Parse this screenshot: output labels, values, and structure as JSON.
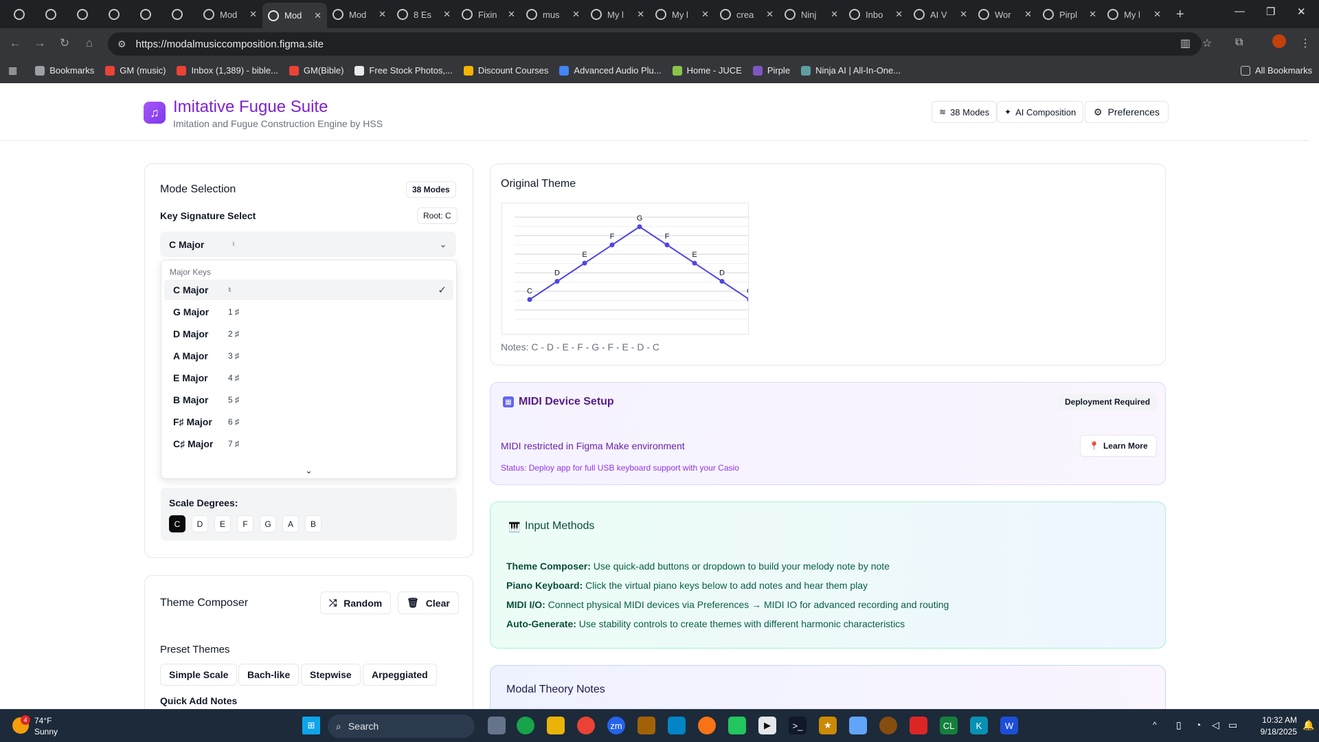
{
  "browser": {
    "tabs": [
      {
        "title": ""
      },
      {
        "title": ""
      },
      {
        "title": ""
      },
      {
        "title": ""
      },
      {
        "title": ""
      },
      {
        "title": ""
      },
      {
        "title": "Mod"
      },
      {
        "title": "Mod"
      },
      {
        "title": "Mod"
      },
      {
        "title": "8 Es"
      },
      {
        "title": "Fixin"
      },
      {
        "title": "mus"
      },
      {
        "title": "My l"
      },
      {
        "title": "My l"
      },
      {
        "title": "crea"
      },
      {
        "title": "Ninj"
      },
      {
        "title": "Inbo"
      },
      {
        "title": "AI V"
      },
      {
        "title": "Wor"
      },
      {
        "title": "Pirpl"
      },
      {
        "title": "My l"
      }
    ],
    "url": "https://modalmusiccomposition.figma.site",
    "bookmarks": [
      {
        "label": "Bookmarks",
        "color": "#9aa0a6"
      },
      {
        "label": "GM (music)",
        "color": "#ea4335"
      },
      {
        "label": "Inbox (1,389) - bible...",
        "color": "#ea4335"
      },
      {
        "label": "GM(Bible)",
        "color": "#ea4335"
      },
      {
        "label": "Free Stock Photos,...",
        "color": "#e8eaed"
      },
      {
        "label": "Discount Courses",
        "color": "#f4b400"
      },
      {
        "label": "Advanced Audio Plu...",
        "color": "#4285f4"
      },
      {
        "label": "Home - JUCE",
        "color": "#8bc34a"
      },
      {
        "label": "Pirple",
        "color": "#7e57c2"
      },
      {
        "label": "Ninja AI | All-In-One...",
        "color": "#5f9ea0"
      }
    ],
    "all_bookmarks": "All Bookmarks"
  },
  "app": {
    "title": "Imitative Fugue Suite",
    "subtitle": "Imitation and Fugue Construction Engine by HSS",
    "header_buttons": {
      "modes": "38 Modes",
      "ai": "AI Composition",
      "prefs": "Preferences"
    }
  },
  "mode_selection": {
    "title": "Mode Selection",
    "badge": "38 Modes",
    "key_label": "Key Signature Select",
    "root_badge": "Root: C",
    "selected": "C Major",
    "selected_acc": "♮",
    "group_label": "Major Keys",
    "options": [
      {
        "name": "C Major",
        "acc": "♮",
        "selected": true
      },
      {
        "name": "G Major",
        "acc": "1 ♯"
      },
      {
        "name": "D Major",
        "acc": "2 ♯"
      },
      {
        "name": "A Major",
        "acc": "3 ♯"
      },
      {
        "name": "E Major",
        "acc": "4 ♯"
      },
      {
        "name": "B Major",
        "acc": "5 ♯"
      },
      {
        "name": "F♯ Major",
        "acc": "6 ♯"
      },
      {
        "name": "C♯ Major",
        "acc": "7 ♯"
      }
    ],
    "scale_label": "Scale Degrees:",
    "scale_degrees": [
      "C",
      "D",
      "E",
      "F",
      "G",
      "A",
      "B"
    ]
  },
  "theme_composer": {
    "title": "Theme Composer",
    "random": "Random",
    "clear": "Clear",
    "presets_label": "Preset Themes",
    "presets": [
      "Simple Scale",
      "Bach-like",
      "Stepwise",
      "Arpeggiated"
    ],
    "quick_add": "Quick Add Notes"
  },
  "original_theme": {
    "title": "Original Theme",
    "notes_text": "Notes: C - D - E - F - G - F - E - D - C",
    "melody": [
      "C",
      "D",
      "E",
      "F",
      "G",
      "F",
      "E",
      "D",
      "C"
    ],
    "line_color": "#4f46e5"
  },
  "midi": {
    "title": "MIDI Device Setup",
    "badge": "Deployment Required",
    "message": "MIDI restricted in Figma Make environment",
    "status": "Status: Deploy app for full USB keyboard support with your Casio",
    "learn_more": "Learn More"
  },
  "input_methods": {
    "title": "Input Methods",
    "items": [
      {
        "label": "Theme Composer:",
        "text": " Use quick-add buttons or dropdown to build your melody note by note"
      },
      {
        "label": "Piano Keyboard:",
        "text": " Click the virtual piano keys below to add notes and hear them play"
      },
      {
        "label": "MIDI I/O:",
        "text": " Connect physical MIDI devices via Preferences → MIDI IO for advanced recording and routing"
      },
      {
        "label": "Auto-Generate:",
        "text": " Use stability controls to create themes with different harmonic characteristics"
      }
    ]
  },
  "theory": {
    "title": "Modal Theory Notes"
  },
  "taskbar": {
    "weather_temp": "74°F",
    "weather_text": "Sunny",
    "weather_badge": "4",
    "search": "Search",
    "time": "10:32 AM",
    "date": "9/18/2025"
  }
}
